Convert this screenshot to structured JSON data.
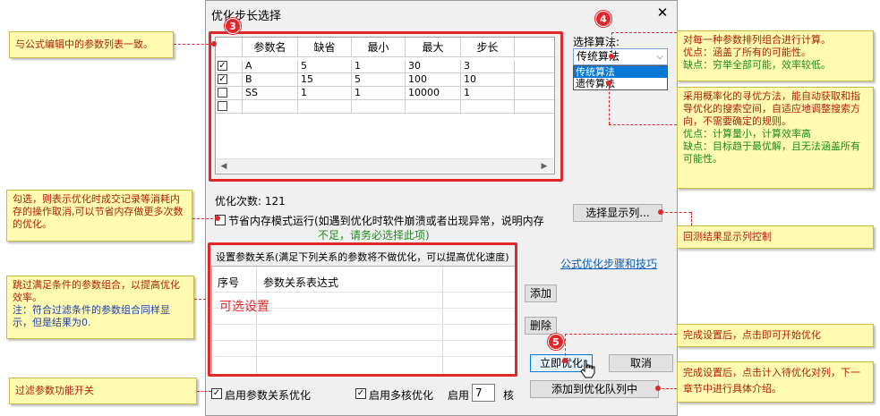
{
  "dialog": {
    "title": "优化步长选择",
    "close_glyph": "✕",
    "grid": {
      "headers": [
        "参数名",
        "缺省",
        "最小",
        "最大",
        "步长"
      ],
      "rows": [
        {
          "checked": true,
          "name": "A",
          "default": "5",
          "min": "1",
          "max": "30",
          "step": "3"
        },
        {
          "checked": true,
          "name": "B",
          "default": "15",
          "min": "5",
          "max": "100",
          "step": "10"
        },
        {
          "checked": false,
          "name": "SS",
          "default": "1",
          "min": "1",
          "max": "10000",
          "step": "1"
        },
        {
          "checked": false,
          "name": "",
          "default": "",
          "min": "",
          "max": "",
          "step": ""
        }
      ]
    },
    "algo_label": "选择算法:",
    "algo_selected": "传统算法",
    "algo_options": [
      "传统算法",
      "遗传算法"
    ],
    "opt_count_label": "优化次数:",
    "opt_count": "121",
    "mem_mode_text": "节省内存模式运行(如遇到优化时软件崩溃或者出现异常，说明内存",
    "mem_mode_note": "不足，请务必选择此项)",
    "select_columns_btn": "选择显示列...",
    "relation_title": "设置参数关系(满足下列关系的参数将不做优化，可以提高优化速度)",
    "help_link": "公式优化步骤和技巧",
    "rel_headers": [
      "序号",
      "参数关系表达式"
    ],
    "optional_text": "可选设置",
    "add_btn": "添加",
    "delete_btn": "删除",
    "start_btn": "立即优化",
    "cancel_btn": "取消",
    "enable_relation": "启用参数关系优化",
    "enable_multicore": "启用多核优化",
    "use_label": "启用",
    "core_count": "7",
    "core_unit": "核",
    "add_queue_btn": "添加到优化队列中"
  },
  "badges": {
    "b3": "3",
    "b4": "4",
    "b5": "5"
  },
  "callouts": {
    "c1": "与公式编辑中的参数列表一致。",
    "c2_line1": "对每一种参数排列组合进行计算。",
    "c2_line2": "优点：涵盖了所有的可能性。",
    "c2_line3": "缺点：穷举全部可能，效率较低。",
    "c3_main": "采用概率化的寻优方法，能自动获取和指导优化的搜索空间，自适应地调整搜索方向，不需要确定的规则。",
    "c3_pro": "优点：计算量小，计算效率高",
    "c3_con": "缺点：目标趋于最优解，且无法涵盖所有可能性。",
    "c4": "勾选，则表示优化时成交记录等消耗内存的操作取消,可以节省内存做更多次数的优化。",
    "c5": "回测结果显示列控制",
    "c6_main": "跳过满足条件的参数组合，以提高优化效率。",
    "c6_note": "注：符合过滤条件的参数组合同样显示，但是结果为0.",
    "c7": "完成设置后，点击即可开始优化",
    "c8": "过滤参数功能开关",
    "c9": "完成设置后，点击计入待优化对列，下一章节中进行具体介绍。"
  },
  "colors": {
    "accent_red": "#e2272a",
    "callout_bg": "#fffbb0",
    "note_green": "#1f8a1f",
    "link_blue": "#0b5fb5"
  }
}
